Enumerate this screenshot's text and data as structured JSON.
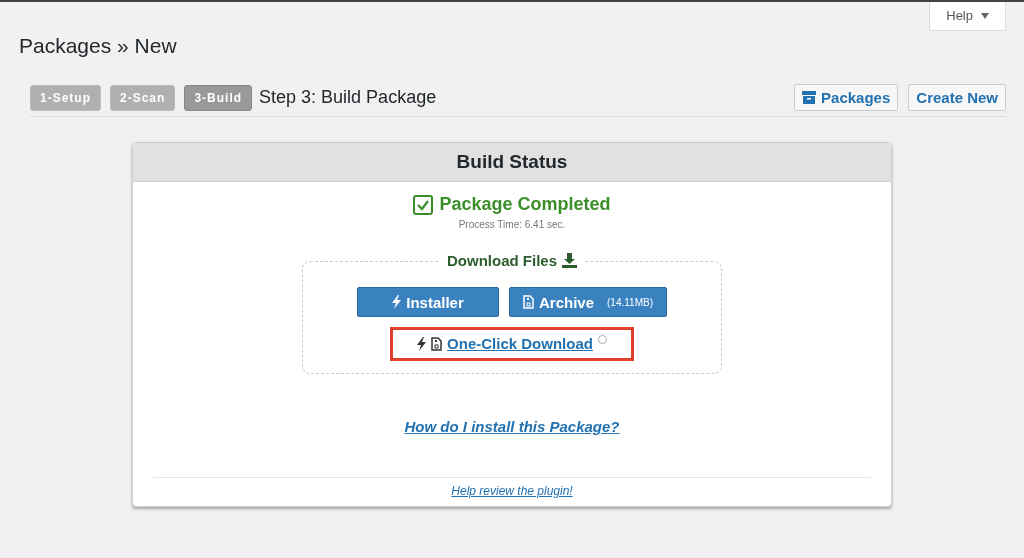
{
  "help_tab": {
    "label": "Help"
  },
  "page_title": "Packages » New",
  "steps": [
    {
      "label": "1-Setup",
      "selected": false
    },
    {
      "label": "2-Scan",
      "selected": false
    },
    {
      "label": "3-Build",
      "selected": true
    }
  ],
  "step_title": "Step 3: Build Package",
  "header_buttons": [
    {
      "label": "Packages",
      "kind": "icon"
    },
    {
      "label": "Create New",
      "kind": "plain"
    }
  ],
  "panel": {
    "title": "Build Status",
    "status": "Package Completed",
    "process_time": "Process Time: 6.41 sec.",
    "download_title": "Download Files",
    "installer_button": "Installer",
    "archive_button": {
      "label": "Archive",
      "size": "(14.11MB)"
    },
    "one_click_link": "One-Click Download",
    "install_link": "How do I install this Package?",
    "review_link": "Help review the plugin!"
  }
}
